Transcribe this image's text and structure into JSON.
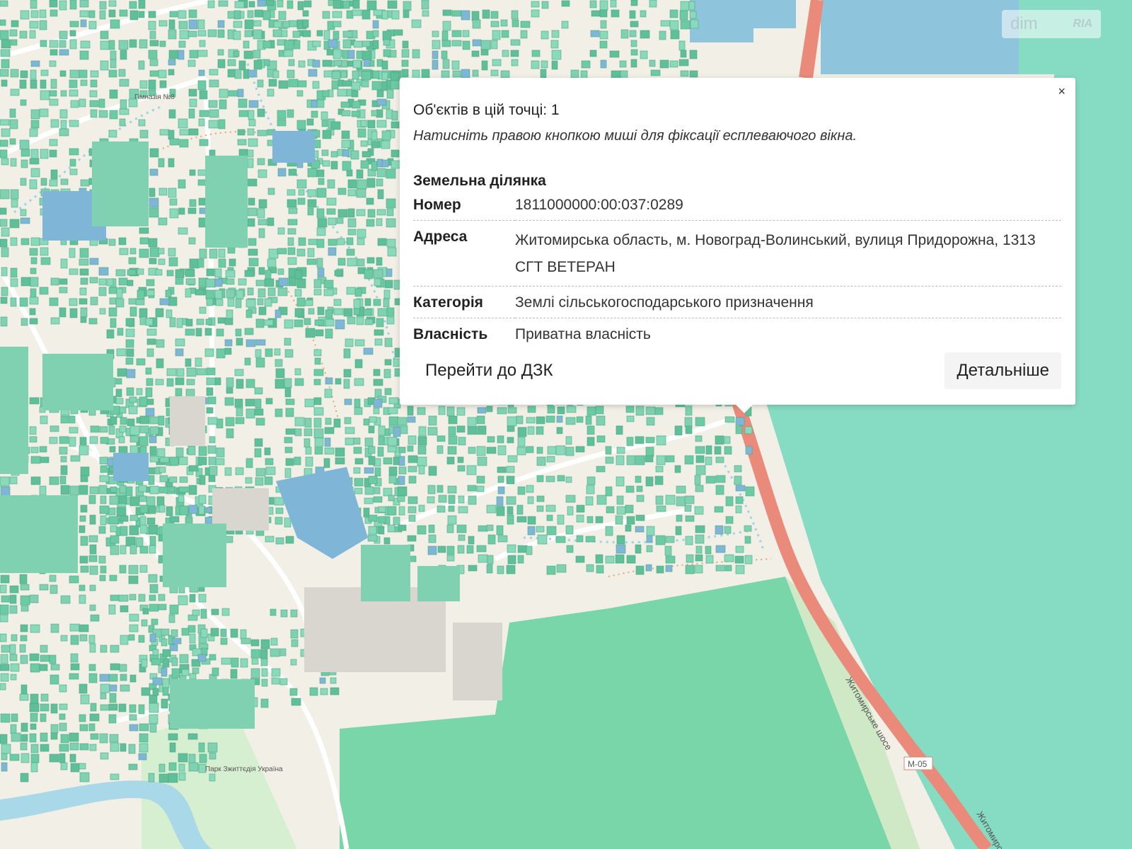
{
  "watermark": {
    "brand": "dim",
    "ria": "RIA"
  },
  "map": {
    "colors": {
      "background": "#f2efe6",
      "parcel_green": "#7fd1b1",
      "parcel_green_dark": "#5bbf99",
      "parcel_blue": "#7fb6d8",
      "large_field": "#78d6a8",
      "field_right": "#86dcc2",
      "road_main": "#e98a7a",
      "river": "#a9d8e8",
      "park": "#cfe9c6"
    },
    "labels": {
      "road_1": "Житомирське шосе",
      "road_2": "Житомирське шосе",
      "road_number": "М-05",
      "gymnasium": "Гімназія №8",
      "park": "Парк Зжиттєдія Україна"
    }
  },
  "popup": {
    "close_icon": "×",
    "objects_count": "Об'єктів в цій точці: 1",
    "hint": "Натисніть правою кнопкою миші для фіксації есплеваючого вікна.",
    "section_title": "Земельна ділянка",
    "rows": [
      {
        "label": "Номер",
        "value": "1811000000:00:037:0289"
      },
      {
        "label": "Адреса",
        "value": "Житомирська область, м. Новоград-Волинський, вулиця Придорожна, 1313 СГТ ВЕТЕРАН"
      },
      {
        "label": "Категорія",
        "value": "Землі сільськогосподарського призначення"
      },
      {
        "label": "Власність",
        "value": "Приватна власність"
      }
    ],
    "go_to_dzk": "Перейти до ДЗК",
    "details": "Детальніше"
  }
}
